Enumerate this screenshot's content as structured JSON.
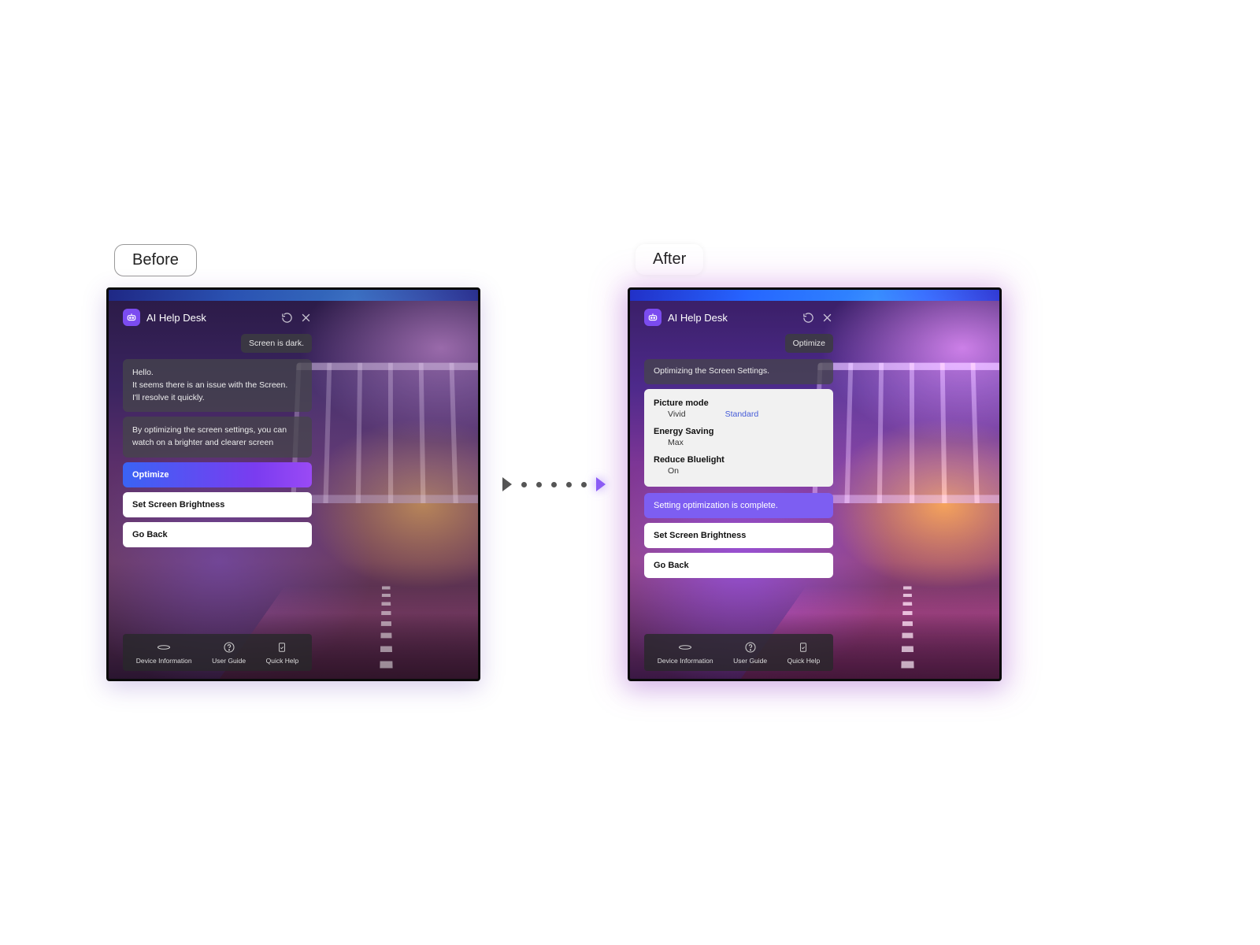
{
  "labels": {
    "before": "Before",
    "after": "After"
  },
  "panel": {
    "title": "AI Help Desk",
    "footer": {
      "device_info": "Device Information",
      "user_guide": "User Guide",
      "quick_help": "Quick Help"
    }
  },
  "before": {
    "user_chip": "Screen is dark.",
    "msg1": "Hello.\nIt seems there is an issue with the Screen.\nI'll resolve it quickly.",
    "msg2": "By optimizing the screen settings, you can watch on a brighter and clearer screen",
    "btn_primary": "Optimize",
    "btn_brightness": "Set Screen Brightness",
    "btn_back": "Go Back"
  },
  "after": {
    "user_chip": "Optimize",
    "status": "Optimizing the Screen Settings.",
    "settings": {
      "picture_mode_label": "Picture mode",
      "picture_mode_current": "Vivid",
      "picture_mode_target": "Standard",
      "energy_label": "Energy Saving",
      "energy_value": "Max",
      "bluelight_label": "Reduce Bluelight",
      "bluelight_value": "On"
    },
    "complete": "Setting optimization is complete.",
    "btn_brightness": "Set Screen Brightness",
    "btn_back": "Go Back"
  }
}
